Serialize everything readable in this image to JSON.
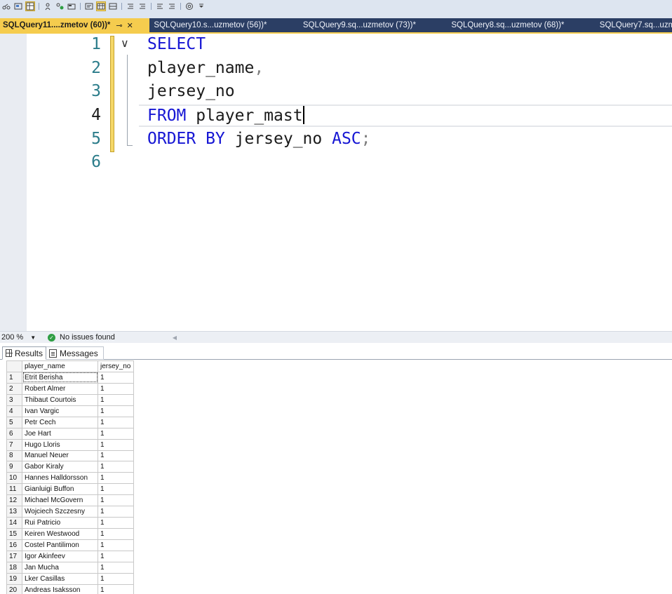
{
  "toolbar": {
    "buttons": [
      "include-actual-plan-icon",
      "display-estimated-plan-icon",
      "results-to-grid-icon",
      "results-to-text-icon",
      "results-to-file-icon",
      "live-statistics-icon",
      "comment-icon",
      "uncomment-icon",
      "decrease-indent-icon",
      "increase-indent-icon",
      "specify-values-icon",
      "toolbar-options-icon"
    ]
  },
  "tabs": {
    "active": {
      "label": "SQLQuery11....zmetov (60))*",
      "pin": "⊸",
      "close": "✕"
    },
    "others": [
      {
        "label": "SQLQuery10.s...uzmetov (56))*"
      },
      {
        "label": "SQLQuery9.sq...uzmetov (73))*"
      },
      {
        "label": "SQLQuery8.sq...uzmetov (68))*"
      },
      {
        "label": "SQLQuery7.sq...uzm"
      }
    ]
  },
  "editor": {
    "line_numbers": [
      "1",
      "2",
      "3",
      "4",
      "5",
      "6"
    ],
    "current_line": 4,
    "lines": {
      "l1_kw": "SELECT",
      "l2_ident": "player_name",
      "l2_punct": ",",
      "l3_ident": "jersey_no",
      "l4_kw": "FROM",
      "l4_ident": " player_mast",
      "l5_kw1": "ORDER BY",
      "l5_ident": " jersey_no ",
      "l5_kw2": "ASC",
      "l5_punct": ";"
    },
    "fold_icon": "∨"
  },
  "status": {
    "zoom": "200 %",
    "zoom_arrow": "▼",
    "issues_icon": "✓",
    "issues_text": "No issues found",
    "scroll_left": "◀"
  },
  "results_tabs": {
    "results_label": "Results",
    "messages_label": "Messages"
  },
  "grid": {
    "columns": [
      "player_name",
      "jersey_no"
    ],
    "rows": [
      {
        "n": "1",
        "player_name": "Etrit Berisha",
        "jersey_no": "1"
      },
      {
        "n": "2",
        "player_name": "Robert Almer",
        "jersey_no": "1"
      },
      {
        "n": "3",
        "player_name": "Thibaut Courtois",
        "jersey_no": "1"
      },
      {
        "n": "4",
        "player_name": "Ivan Vargic",
        "jersey_no": "1"
      },
      {
        "n": "5",
        "player_name": "Petr Cech",
        "jersey_no": "1"
      },
      {
        "n": "6",
        "player_name": "Joe Hart",
        "jersey_no": "1"
      },
      {
        "n": "7",
        "player_name": "Hugo Lloris",
        "jersey_no": "1"
      },
      {
        "n": "8",
        "player_name": "Manuel Neuer",
        "jersey_no": "1"
      },
      {
        "n": "9",
        "player_name": "Gabor Kiraly",
        "jersey_no": "1"
      },
      {
        "n": "10",
        "player_name": "Hannes Halldorsson",
        "jersey_no": "1"
      },
      {
        "n": "11",
        "player_name": "Gianluigi Buffon",
        "jersey_no": "1"
      },
      {
        "n": "12",
        "player_name": "Michael McGovern",
        "jersey_no": "1"
      },
      {
        "n": "13",
        "player_name": "Wojciech Szczesny",
        "jersey_no": "1"
      },
      {
        "n": "14",
        "player_name": "Rui Patricio",
        "jersey_no": "1"
      },
      {
        "n": "15",
        "player_name": "Keiren Westwood",
        "jersey_no": "1"
      },
      {
        "n": "16",
        "player_name": "Costel Pantilimon",
        "jersey_no": "1"
      },
      {
        "n": "17",
        "player_name": "Igor Akinfeev",
        "jersey_no": "1"
      },
      {
        "n": "18",
        "player_name": "Jan Mucha",
        "jersey_no": "1"
      },
      {
        "n": "19",
        "player_name": "Lker Casillas",
        "jersey_no": "1"
      },
      {
        "n": "20",
        "player_name": "Andreas Isaksson",
        "jersey_no": "1"
      }
    ]
  }
}
